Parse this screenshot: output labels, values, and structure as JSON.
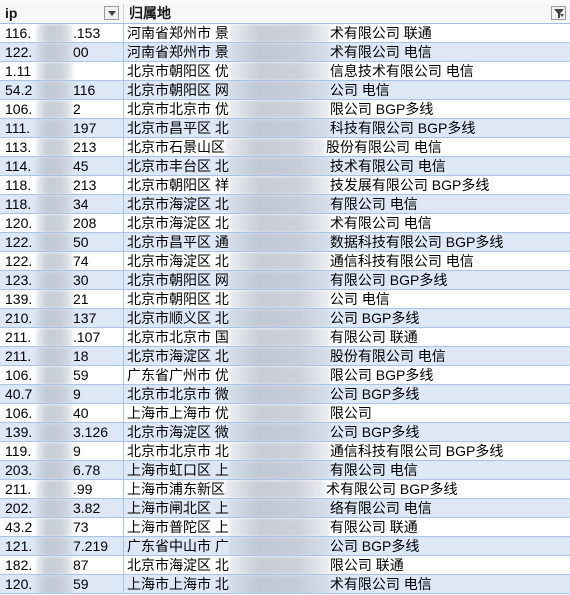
{
  "sheet": {
    "columns": [
      {
        "label": "ip"
      },
      {
        "label": "归属地"
      }
    ],
    "rows": [
      {
        "ip_prefix": "116.",
        "ip_suffix": ".153",
        "loc_left": "河南省郑州市 景",
        "loc_right": "术有限公司 联通"
      },
      {
        "ip_prefix": "122.",
        "ip_suffix": "00",
        "loc_left": "河南省郑州市 景",
        "loc_right": "术有限公司 电信"
      },
      {
        "ip_prefix": "1.11",
        "ip_suffix": "",
        "loc_left": "北京市朝阳区 优",
        "loc_right": "信息技术有限公司 电信"
      },
      {
        "ip_prefix": "54.2",
        "ip_suffix": "116",
        "loc_left": "北京市朝阳区 网",
        "loc_right": "公司 电信"
      },
      {
        "ip_prefix": "106.",
        "ip_suffix": "2",
        "loc_left": "北京市北京市 优",
        "loc_right": "限公司 BGP多线"
      },
      {
        "ip_prefix": "111.",
        "ip_suffix": "197",
        "loc_left": "北京市昌平区 北",
        "loc_right": "科技有限公司 BGP多线"
      },
      {
        "ip_prefix": "113.",
        "ip_suffix": "213",
        "loc_left": "北京市石景山区 ",
        "loc_right": "股份有限公司 电信"
      },
      {
        "ip_prefix": "114.",
        "ip_suffix": "45",
        "loc_left": "北京市丰台区 北",
        "loc_right": "技术有限公司 电信"
      },
      {
        "ip_prefix": "118.",
        "ip_suffix": "213",
        "loc_left": "北京市朝阳区 祥",
        "loc_right": "技发展有限公司 BGP多线"
      },
      {
        "ip_prefix": "118.",
        "ip_suffix": "34",
        "loc_left": "北京市海淀区 北",
        "loc_right": "有限公司 电信"
      },
      {
        "ip_prefix": "120.",
        "ip_suffix": "208",
        "loc_left": "北京市海淀区 北",
        "loc_right": "术有限公司 电信"
      },
      {
        "ip_prefix": "122.",
        "ip_suffix": "50",
        "loc_left": "北京市昌平区 通",
        "loc_right": "数据科技有限公司 BGP多线"
      },
      {
        "ip_prefix": "122.",
        "ip_suffix": "74",
        "loc_left": "北京市海淀区 北",
        "loc_right": "通信科技有限公司 电信"
      },
      {
        "ip_prefix": "123.",
        "ip_suffix": "30",
        "loc_left": "北京市朝阳区 网",
        "loc_right": "有限公司 BGP多线"
      },
      {
        "ip_prefix": "139.",
        "ip_suffix": "21",
        "loc_left": "北京市朝阳区 北",
        "loc_right": "公司 电信"
      },
      {
        "ip_prefix": "210.",
        "ip_suffix": "137",
        "loc_left": "北京市顺义区 北",
        "loc_right": "公司 BGP多线"
      },
      {
        "ip_prefix": "211.",
        "ip_suffix": ".107",
        "loc_left": "北京市北京市 国",
        "loc_right": "有限公司 联通"
      },
      {
        "ip_prefix": "211.",
        "ip_suffix": "18",
        "loc_left": "北京市海淀区 北",
        "loc_right": "股份有限公司 电信"
      },
      {
        "ip_prefix": "106.",
        "ip_suffix": "59",
        "loc_left": "广东省广州市 优",
        "loc_right": "限公司 BGP多线"
      },
      {
        "ip_prefix": "40.7",
        "ip_suffix": "9",
        "loc_left": "北京市北京市 微",
        "loc_right": "公司 BGP多线"
      },
      {
        "ip_prefix": "106.",
        "ip_suffix": "40",
        "loc_left": "上海市上海市 优",
        "loc_right": "限公司"
      },
      {
        "ip_prefix": "139.",
        "ip_suffix": "3.126",
        "loc_left": "北京市海淀区 微",
        "loc_right": "公司 BGP多线"
      },
      {
        "ip_prefix": "119.",
        "ip_suffix": "9",
        "loc_left": "北京市北京市 北",
        "loc_right": "通信科技有限公司 BGP多线"
      },
      {
        "ip_prefix": "203.",
        "ip_suffix": "6.78",
        "loc_left": "上海市虹口区 上",
        "loc_right": "有限公司 电信"
      },
      {
        "ip_prefix": "211.",
        "ip_suffix": ".99",
        "loc_left": "上海市浦东新区 ",
        "loc_right": "术有限公司 BGP多线"
      },
      {
        "ip_prefix": "202.",
        "ip_suffix": "3.82",
        "loc_left": "上海市闸北区 上",
        "loc_right": "络有限公司 电信"
      },
      {
        "ip_prefix": "43.2",
        "ip_suffix": "73",
        "loc_left": "上海市普陀区 上",
        "loc_right": "有限公司 联通"
      },
      {
        "ip_prefix": "121.",
        "ip_suffix": "7.219",
        "loc_left": "广东省中山市 广",
        "loc_right": "公司 BGP多线"
      },
      {
        "ip_prefix": "182.",
        "ip_suffix": "87",
        "loc_left": "北京市海淀区 北",
        "loc_right": "限公司 联通"
      },
      {
        "ip_prefix": "120.",
        "ip_suffix": "59",
        "loc_left": "上海市上海市 北",
        "loc_right": "术有限公司 电信"
      }
    ]
  }
}
